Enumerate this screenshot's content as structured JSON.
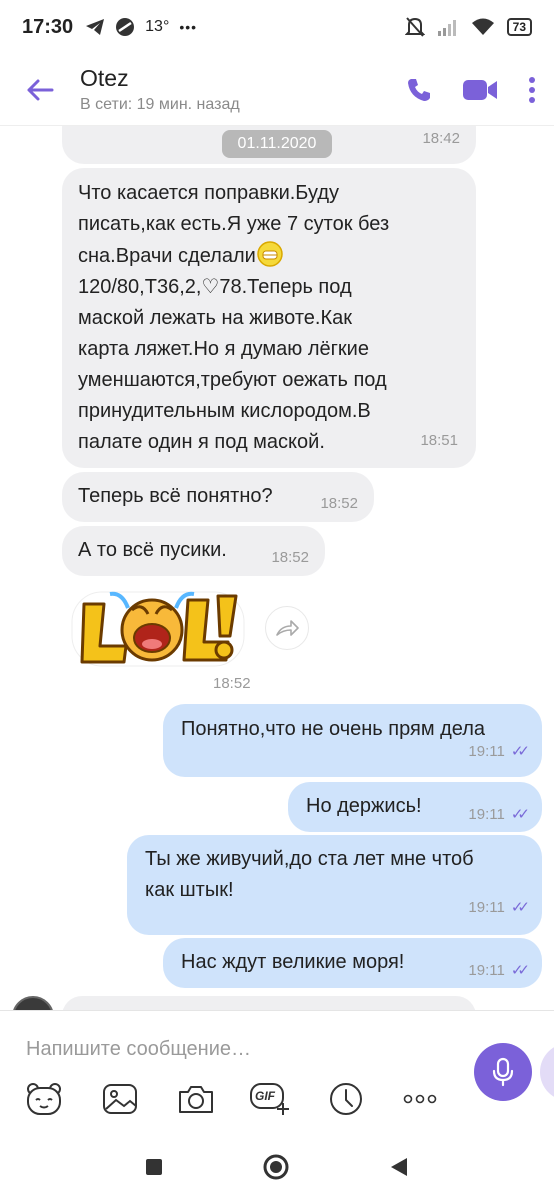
{
  "status_bar": {
    "time": "17:30",
    "temperature": "13°",
    "more": "•••",
    "battery": "73"
  },
  "header": {
    "contact_name": "Otez",
    "contact_status": "В сети: 19 мин. назад"
  },
  "chat": {
    "date_pill": "01.11.2020",
    "messages": [
      {
        "direction": "in",
        "text": "",
        "time": "18:42"
      },
      {
        "direction": "in",
        "text_lines": [
          "Что касается поправки.Буду",
          "писать,как есть.Я уже 7 суток без",
          "сна.Врачи сделали",
          "120/80,Т36,2,♡78.Теперь под",
          "маской лежать на животе.Как",
          "карта ляжет.Но я думаю лёгкие",
          "уменшаются,требуют оежать под",
          "принудительным кислородом.В",
          "палате один я под маской."
        ],
        "time": "18:51"
      },
      {
        "direction": "in",
        "text": "Теперь всё понятно?",
        "time": "18:52"
      },
      {
        "direction": "in",
        "text": "А то всё пусики.",
        "time": "18:52"
      },
      {
        "direction": "in",
        "sticker": "LOL!",
        "time": "18:52"
      },
      {
        "direction": "out",
        "text": "Понятно,что не очень прям дела",
        "time": "19:11"
      },
      {
        "direction": "out",
        "text": "Но держись!",
        "time": "19:11"
      },
      {
        "direction": "out",
        "text_lines": [
          "Ты же живучий,до ста лет мне чтоб",
          "как штык!"
        ],
        "time": "19:11"
      },
      {
        "direction": "out",
        "text": "Нас ждут великие моря!",
        "time": "19:11"
      }
    ]
  },
  "composer": {
    "placeholder": "Напишите сообщение…",
    "gif_label": "GIF"
  },
  "colors": {
    "accent": "#7b61d9",
    "incoming_bubble": "#efeff1",
    "outgoing_bubble": "#cfe3fb"
  }
}
